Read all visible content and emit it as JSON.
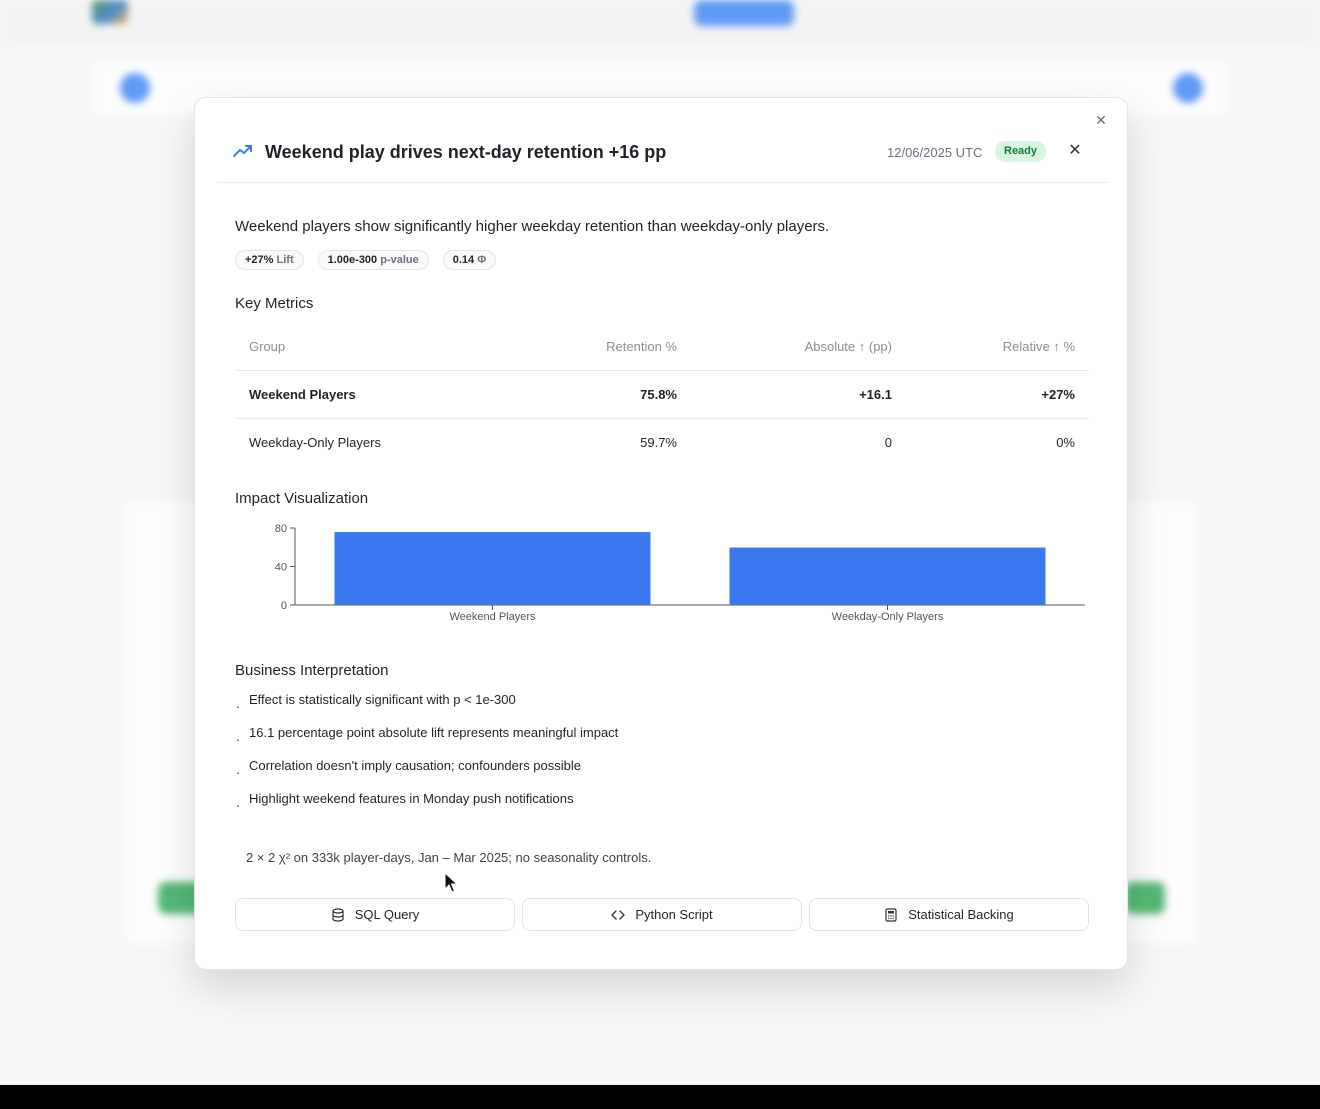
{
  "modal": {
    "title": "Weekend play drives next-day retention +16 pp",
    "date": "12/06/2025 UTC",
    "status": "Ready",
    "summary": "Weekend players show significantly higher weekday retention than weekday-only players.",
    "chips": [
      {
        "value": "+27%",
        "label": "Lift"
      },
      {
        "value": "1.00e-300",
        "label": "p-value"
      },
      {
        "value": "0.14",
        "label": "Φ"
      }
    ],
    "key_metrics": {
      "title": "Key Metrics",
      "headers": [
        "Group",
        "Retention %",
        "Absolute ↑ (pp)",
        "Relative ↑ %"
      ],
      "rows": [
        [
          "Weekend Players",
          "75.8%",
          "+16.1",
          "+27%"
        ],
        [
          "Weekday-Only Players",
          "59.7%",
          "0",
          "0%"
        ]
      ]
    },
    "impact": {
      "title": "Impact Visualization"
    },
    "interpretation": {
      "title": "Business Interpretation",
      "items": [
        "Effect is statistically significant with p < 1e-300",
        "16.1 percentage point absolute lift represents meaningful impact",
        "Correlation doesn't imply causation; confounders possible",
        "Highlight weekend features in Monday push notifications"
      ]
    },
    "footnote": "2 × 2 χ² on 333k player-days, Jan – Mar 2025; no seasonality controls.",
    "actions": [
      {
        "label": "SQL Query",
        "icon": "database-icon"
      },
      {
        "label": "Python Script",
        "icon": "code-icon"
      },
      {
        "label": "Statistical Backing",
        "icon": "calculator-icon"
      }
    ]
  },
  "chart_data": {
    "type": "bar",
    "categories": [
      "Weekend Players",
      "Weekday-Only Players"
    ],
    "values": [
      75.8,
      59.7
    ],
    "ylim": [
      0,
      80
    ],
    "yticks": [
      0,
      40,
      80
    ],
    "title": "",
    "xlabel": "",
    "ylabel": "",
    "color": "#3b78f0",
    "grid": false
  },
  "colors": {
    "accent": "#2f7cf6",
    "ready_bg": "#d9f5e2",
    "ready_text": "#127a3a"
  }
}
